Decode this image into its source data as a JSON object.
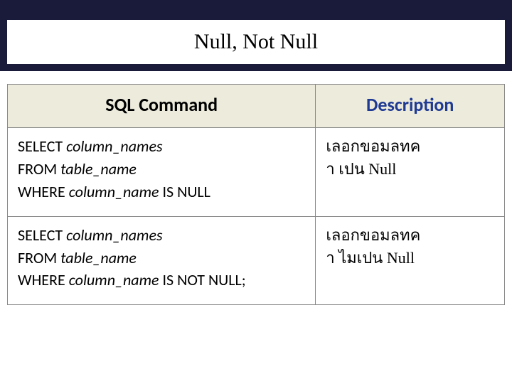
{
  "title": "Null, Not Null",
  "table": {
    "headers": {
      "sql": "SQL Command",
      "desc": "Description"
    },
    "rows": [
      {
        "sql_line1_a": "SELECT ",
        "sql_line1_b": "column_names",
        "sql_line2_a": "FROM ",
        "sql_line2_b": "table_name",
        "sql_line3_a": "WHERE ",
        "sql_line3_b": "column_name",
        "sql_line3_c": " IS NULL",
        "desc_line1": "เลอกขอมลทค",
        "desc_line2_a": "า   เปน   ",
        "desc_line2_b": "Null"
      },
      {
        "sql_line1_a": "SELECT ",
        "sql_line1_b": "column_names",
        "sql_line2_a": "FROM ",
        "sql_line2_b": "table_name",
        "sql_line3_a": "WHERE ",
        "sql_line3_b": "column_name",
        "sql_line3_c": " IS NOT NULL;",
        "desc_line1": "เลอกขอมลทค",
        "desc_line2_a": "า   ไมเปน     ",
        "desc_line2_b": "Null"
      }
    ]
  }
}
